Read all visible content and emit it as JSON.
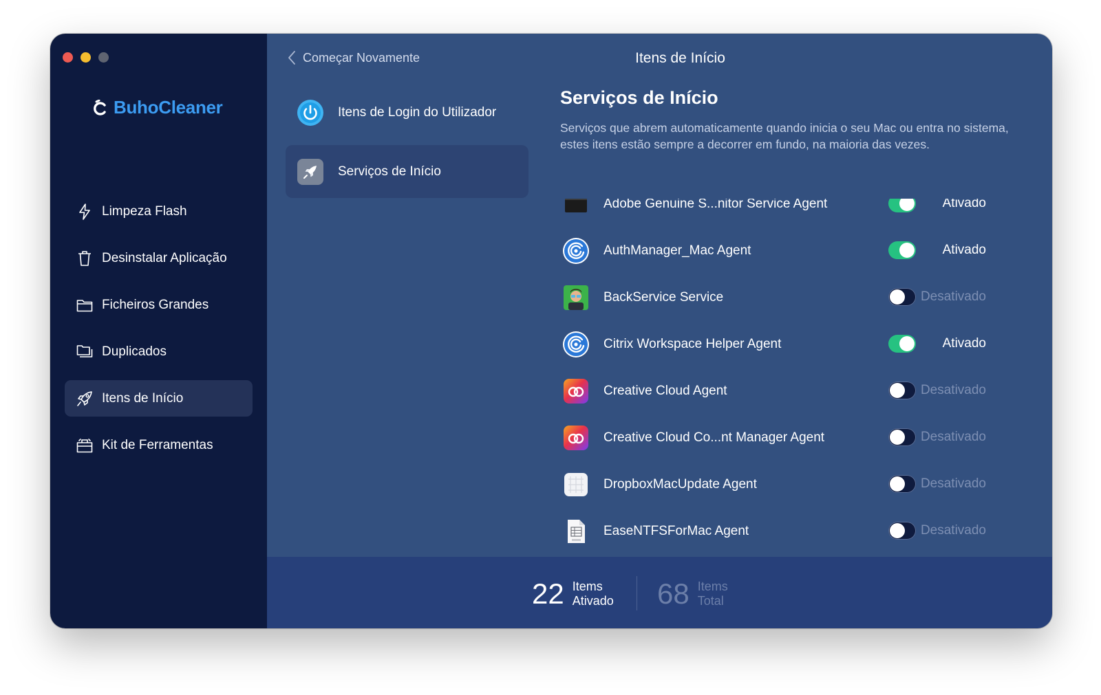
{
  "app": {
    "name": "BuhoCleaner",
    "brand_color": "#3c9cf2"
  },
  "sidebar": {
    "items": [
      {
        "label": "Limpeza Flash",
        "icon": "lightning-icon",
        "active": false
      },
      {
        "label": "Desinstalar Aplicação",
        "icon": "trash-icon",
        "active": false
      },
      {
        "label": "Ficheiros Grandes",
        "icon": "folder-icon",
        "active": false
      },
      {
        "label": "Duplicados",
        "icon": "duplicate-folders-icon",
        "active": false
      },
      {
        "label": "Itens de Início",
        "icon": "rocket-icon",
        "active": true
      },
      {
        "label": "Kit de Ferramentas",
        "icon": "toolbox-icon",
        "active": false
      }
    ]
  },
  "header": {
    "back_label": "Começar Novamente",
    "title": "Itens de Início"
  },
  "categories": [
    {
      "label": "Itens de Login do Utilizador",
      "icon": "power-icon",
      "active": false
    },
    {
      "label": "Serviços de Início",
      "icon": "rocket-icon",
      "active": true
    }
  ],
  "section": {
    "title": "Serviços de Início",
    "description": "Serviços que abrem automaticamente quando inicia o seu Mac ou entra no sistema, estes itens estão sempre a decorrer em fundo, na maioria das vezes."
  },
  "services": [
    {
      "name": "Adobe Genuine S...nitor Service Agent",
      "icon": "adobe-genuine-icon",
      "enabled": true,
      "status": "Ativado"
    },
    {
      "name": "AuthManager_Mac Agent",
      "icon": "citrix-icon",
      "enabled": true,
      "status": "Ativado"
    },
    {
      "name": "BackService Service",
      "icon": "backservice-avatar-icon",
      "enabled": false,
      "status": "Desativado"
    },
    {
      "name": "Citrix Workspace Helper Agent",
      "icon": "citrix-icon",
      "enabled": true,
      "status": "Ativado"
    },
    {
      "name": "Creative Cloud Agent",
      "icon": "creative-cloud-icon",
      "enabled": false,
      "status": "Desativado"
    },
    {
      "name": "Creative Cloud Co...nt Manager Agent",
      "icon": "creative-cloud-icon",
      "enabled": false,
      "status": "Desativado"
    },
    {
      "name": "DropboxMacUpdate Agent",
      "icon": "dropbox-update-icon",
      "enabled": false,
      "status": "Desativado"
    },
    {
      "name": "EaseNTFSForMac Agent",
      "icon": "plist-file-icon",
      "enabled": false,
      "status": "Desativado"
    }
  ],
  "footer": {
    "enabled_count": "22",
    "enabled_label_1": "Items",
    "enabled_label_2": "Ativado",
    "total_count": "68",
    "total_label_1": "Items",
    "total_label_2": "Total"
  },
  "colors": {
    "toggle_on": "#26c281",
    "sidebar_bg": "#0d1a3f",
    "main_bg": "#33507f"
  }
}
